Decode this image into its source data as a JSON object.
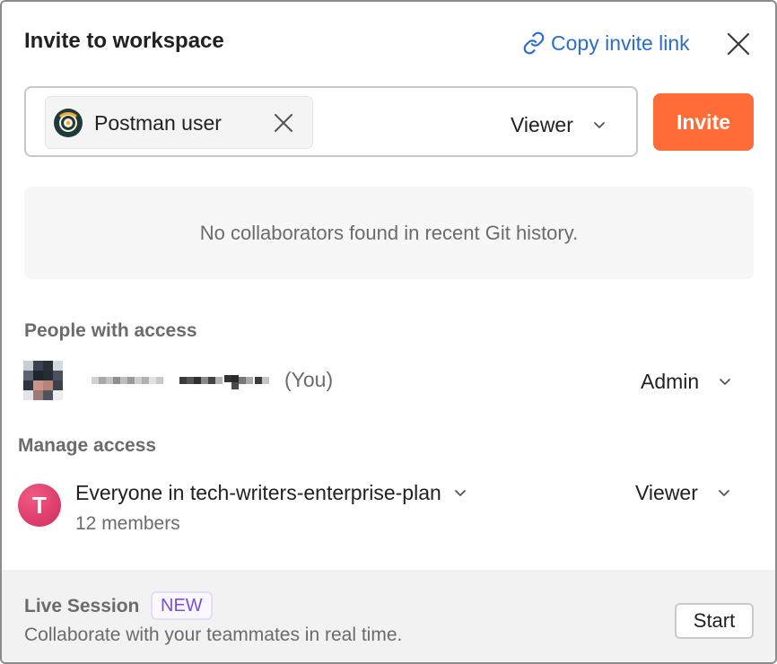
{
  "header": {
    "title": "Invite to workspace",
    "copy_link_label": "Copy invite link"
  },
  "invite": {
    "chip_label": "Postman user",
    "role": "Viewer",
    "button_label": "Invite"
  },
  "empty_state": {
    "message": "No collaborators found in recent Git history."
  },
  "people_with_access": {
    "heading": "People with access",
    "user_suffix": "(You)",
    "user_role": "Admin"
  },
  "manage_access": {
    "heading": "Manage access",
    "team_initial": "T",
    "team_name": "Everyone in tech-writers-enterprise-plan",
    "team_members": "12 members",
    "team_role": "Viewer"
  },
  "footer": {
    "title": "Live Session",
    "badge": "NEW",
    "description": "Collaborate with your teammates in real time.",
    "start_label": "Start"
  },
  "colors": {
    "accent": "#ff6c37",
    "link": "#2b6cd3",
    "badge": "#7c4ed8",
    "team_avatar": "#d12c5e"
  }
}
